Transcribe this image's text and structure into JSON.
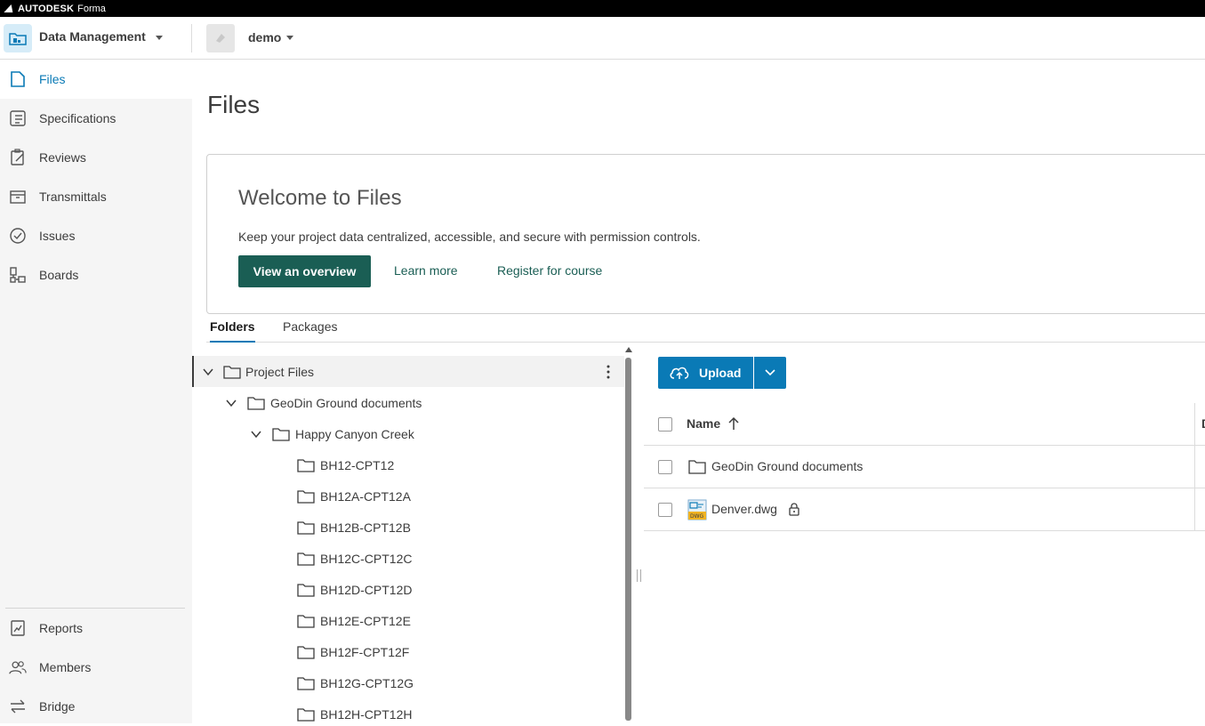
{
  "topbar": {
    "brand": "AUTODESK",
    "product": "Forma"
  },
  "header": {
    "module_title": "Data Management",
    "project_name": "demo"
  },
  "sidebar": {
    "items": [
      {
        "label": "Files",
        "icon": "file-icon",
        "active": true
      },
      {
        "label": "Specifications",
        "icon": "specifications-icon"
      },
      {
        "label": "Reviews",
        "icon": "reviews-icon"
      },
      {
        "label": "Transmittals",
        "icon": "transmittals-icon"
      },
      {
        "label": "Issues",
        "icon": "issues-icon"
      },
      {
        "label": "Boards",
        "icon": "boards-icon"
      }
    ],
    "bottom_items": [
      {
        "label": "Reports",
        "icon": "reports-icon"
      },
      {
        "label": "Members",
        "icon": "members-icon"
      },
      {
        "label": "Bridge",
        "icon": "bridge-icon"
      }
    ]
  },
  "page": {
    "title": "Files"
  },
  "welcome": {
    "title": "Welcome to Files",
    "description": "Keep your project data centralized, accessible, and secure with permission controls.",
    "primary_button": "View an overview",
    "link_learn": "Learn more",
    "link_register": "Register for course"
  },
  "tabs": [
    {
      "label": "Folders",
      "active": true
    },
    {
      "label": "Packages"
    }
  ],
  "tree": [
    {
      "name": "Project Files",
      "level": 0,
      "expanded": true
    },
    {
      "name": "GeoDin Ground documents",
      "level": 1,
      "expanded": true
    },
    {
      "name": "Happy Canyon Creek",
      "level": 2,
      "expanded": true
    },
    {
      "name": "BH12-CPT12",
      "level": 3
    },
    {
      "name": "BH12A-CPT12A",
      "level": 3
    },
    {
      "name": "BH12B-CPT12B",
      "level": 3
    },
    {
      "name": "BH12C-CPT12C",
      "level": 3
    },
    {
      "name": "BH12D-CPT12D",
      "level": 3
    },
    {
      "name": "BH12E-CPT12E",
      "level": 3
    },
    {
      "name": "BH12F-CPT12F",
      "level": 3
    },
    {
      "name": "BH12G-CPT12G",
      "level": 3
    },
    {
      "name": "BH12H-CPT12H",
      "level": 3
    }
  ],
  "toolbar": {
    "upload_label": "Upload"
  },
  "files_table": {
    "name_header": "Name",
    "next_header_fragment": "D",
    "rows": [
      {
        "name": "GeoDin Ground documents",
        "type": "folder"
      },
      {
        "name": "Denver.dwg",
        "type": "dwg",
        "locked": true,
        "badge": "DWG"
      }
    ]
  },
  "colors": {
    "accent": "#0a7ab6",
    "primary_button": "#1a5e54",
    "topbar": "#000000",
    "sidebar_bg": "#f5f5f5"
  }
}
